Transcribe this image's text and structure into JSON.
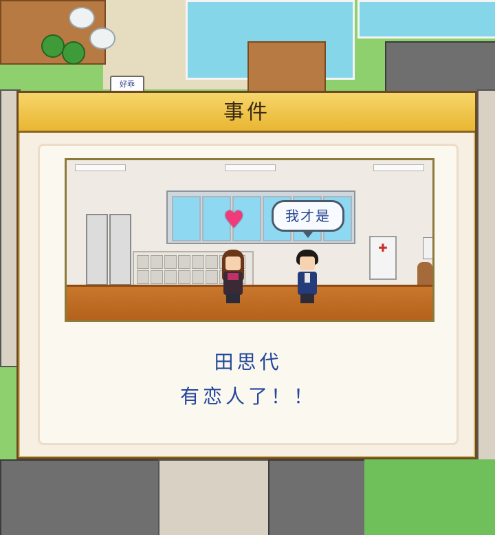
{
  "map": {
    "sign_label": "好乖"
  },
  "dialog": {
    "title": "事件",
    "scene": {
      "speech_text": "我才是",
      "heart_icon": "heart-icon",
      "colors": {
        "heart": "#f23a7a",
        "speech_text": "#1f3f8f"
      }
    },
    "message": {
      "name": "田思代",
      "text": "有恋人了！！"
    }
  },
  "colors": {
    "header_gold": "#e9b632",
    "message_blue": "#23469b",
    "panel_bg": "#fbf8f0"
  }
}
